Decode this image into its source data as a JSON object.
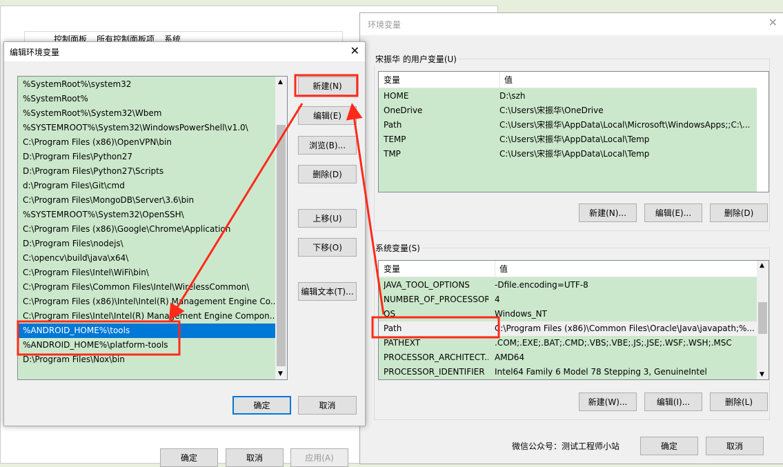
{
  "background_window": {
    "breadcrumb": [
      "控制面板",
      "所有控制面板项",
      "系统"
    ],
    "buttons": {
      "ok": "确定",
      "cancel": "取消",
      "apply": "应用(A)"
    }
  },
  "edit_dialog": {
    "title": "编辑环境变量",
    "items": [
      "%SystemRoot%\\system32",
      "%SystemRoot%",
      "%SystemRoot%\\System32\\Wbem",
      "%SYSTEMROOT%\\System32\\WindowsPowerShell\\v1.0\\",
      "C:\\Program Files (x86)\\OpenVPN\\bin",
      "D:\\Program Files\\Python27",
      "D:\\Program Files\\Python27\\Scripts",
      "d:\\Program Files\\Git\\cmd",
      "C:\\Program Files\\MongoDB\\Server\\3.6\\bin",
      "%SYSTEMROOT%\\System32\\OpenSSH\\",
      "C:\\Program Files (x86)\\Google\\Chrome\\Application",
      "D:\\Program Files\\nodejs\\",
      "C:\\opencv\\build\\java\\x64\\",
      "C:\\Program Files\\Intel\\WiFi\\bin\\",
      "C:\\Program Files\\Common Files\\Intel\\WirelessCommon\\",
      "C:\\Program Files (x86)\\Intel\\Intel(R) Management Engine Co...",
      "C:\\Program Files\\Intel\\Intel(R) Management Engine Compon...",
      "%ANDROID_HOME%\\tools",
      "%ANDROID_HOME%\\platform-tools",
      "D:\\Program Files\\Nox\\bin"
    ],
    "selected_index": 17,
    "buttons": {
      "new": "新建(N)",
      "edit": "编辑(E)",
      "browse": "浏览(B)...",
      "delete": "删除(D)",
      "up": "上移(U)",
      "down": "下移(O)",
      "edit_text": "编辑文本(T)...",
      "ok": "确定",
      "cancel": "取消"
    }
  },
  "env_window": {
    "title": "环境变量",
    "user_group": "宋振华 的用户变量(U)",
    "col_var": "变量",
    "col_val": "值",
    "user_vars": [
      [
        "HOME",
        "D:\\szh"
      ],
      [
        "OneDrive",
        "C:\\Users\\宋振华\\OneDrive"
      ],
      [
        "Path",
        "C:\\Users\\宋振华\\AppData\\Local\\Microsoft\\WindowsApps;;C:\\..."
      ],
      [
        "TEMP",
        "C:\\Users\\宋振华\\AppData\\Local\\Temp"
      ],
      [
        "TMP",
        "C:\\Users\\宋振华\\AppData\\Local\\Temp"
      ]
    ],
    "user_buttons": {
      "new": "新建(N)...",
      "edit": "编辑(E)...",
      "delete": "删除(D)"
    },
    "system_group": "系统变量(S)",
    "system_vars": [
      [
        "JAVA_TOOL_OPTIONS",
        "-Dfile.encoding=UTF-8"
      ],
      [
        "NUMBER_OF_PROCESSORS",
        "4"
      ],
      [
        "OS",
        "Windows_NT"
      ],
      [
        "Path",
        "C:\\Program Files (x86)\\Common Files\\Oracle\\Java\\javapath;%..."
      ],
      [
        "PATHEXT",
        ".COM;.EXE;.BAT;.CMD;.VBS;.VBE;.JS;.JSE;.WSF;.WSH;.MSC"
      ],
      [
        "PROCESSOR_ARCHITECT...",
        "AMD64"
      ],
      [
        "PROCESSOR_IDENTIFIER",
        "Intel64 Family 6 Model 78 Stepping 3, GenuineIntel"
      ]
    ],
    "system_selected_index": 3,
    "system_buttons": {
      "new": "新建(W)...",
      "edit": "编辑(I)...",
      "delete": "删除(L)"
    },
    "watermark": "微信公众号：测试工程师小站",
    "ok": "确定",
    "cancel": "取消"
  },
  "colors": {
    "list_bg": "#cce8cc",
    "selection": "#0078d7",
    "annotation": "#ff2a1a"
  }
}
